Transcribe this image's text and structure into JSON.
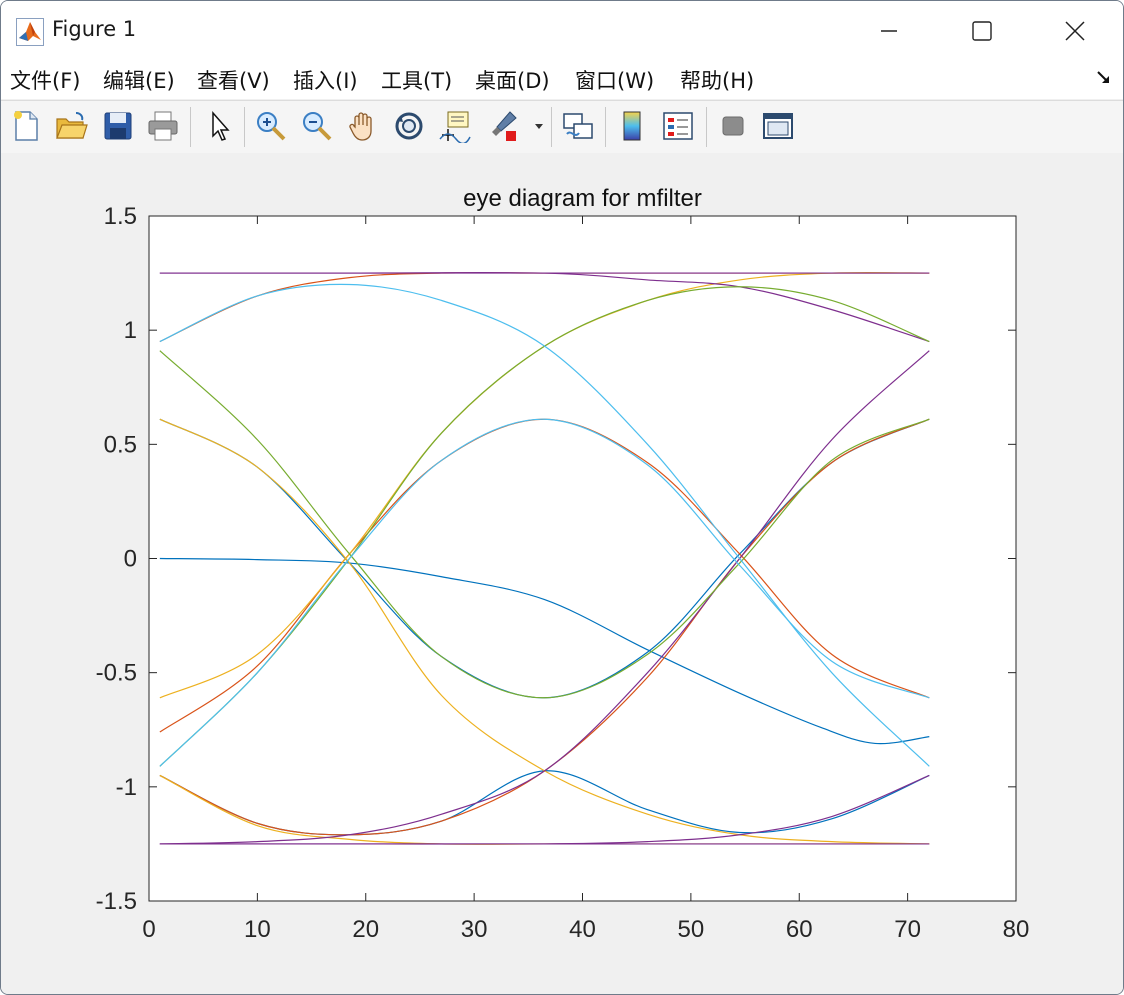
{
  "window": {
    "title": "Figure 1"
  },
  "menu": [
    {
      "label": "文件(F)"
    },
    {
      "label": "编辑(E)"
    },
    {
      "label": "查看(V)"
    },
    {
      "label": "插入(I)"
    },
    {
      "label": "工具(T)"
    },
    {
      "label": "桌面(D)"
    },
    {
      "label": "窗口(W)"
    },
    {
      "label": "帮助(H)"
    }
  ],
  "toolbar": [
    {
      "icon": "new-figure-icon"
    },
    {
      "icon": "open-file-icon"
    },
    {
      "icon": "save-icon"
    },
    {
      "icon": "print-icon"
    },
    {
      "icon": "pointer-icon"
    },
    {
      "icon": "zoom-in-icon"
    },
    {
      "icon": "zoom-out-icon"
    },
    {
      "icon": "pan-icon"
    },
    {
      "icon": "rotate-3d-icon"
    },
    {
      "icon": "data-cursor-icon"
    },
    {
      "icon": "brush-icon"
    },
    {
      "icon": "link-icon"
    },
    {
      "icon": "colorbar-icon"
    },
    {
      "icon": "legend-icon"
    },
    {
      "icon": "hide-plot-tools-icon"
    },
    {
      "icon": "show-plot-tools-icon"
    }
  ],
  "chart_data": {
    "type": "line",
    "title": "eye diagram for mfilter",
    "xlabel": "",
    "ylabel": "",
    "xlim": [
      0,
      80
    ],
    "ylim": [
      -1.5,
      1.5
    ],
    "xticks": [
      0,
      10,
      20,
      30,
      40,
      50,
      60,
      70,
      80
    ],
    "yticks": [
      1.5,
      1,
      0.5,
      0,
      -0.5,
      -1,
      -1.5
    ],
    "ytick_labels": [
      "1.5",
      "1",
      "0.5",
      "0",
      "-0.5",
      "-1",
      "-1.5"
    ],
    "grid": false,
    "colors": [
      "#0072bd",
      "#d95319",
      "#edb120",
      "#7e2f8e",
      "#77ac30",
      "#4dbeee"
    ],
    "series": [
      {
        "color": "#0072bd",
        "points": [
          [
            1,
            0
          ],
          [
            10,
            -0.005
          ],
          [
            18.5,
            -0.02
          ],
          [
            27,
            -0.08
          ],
          [
            36.5,
            -0.18
          ],
          [
            46,
            -0.4
          ],
          [
            54.5,
            -0.59
          ],
          [
            62,
            -0.74
          ],
          [
            67,
            -0.81
          ],
          [
            72,
            -0.78
          ]
        ]
      },
      {
        "color": "#0072bd",
        "points": [
          [
            1,
            0.61
          ],
          [
            10,
            0.4
          ],
          [
            18.5,
            -0.02
          ],
          [
            27,
            -0.43
          ],
          [
            36.5,
            -0.61
          ],
          [
            46,
            -0.41
          ],
          [
            54.5,
            0.02
          ],
          [
            63,
            0.42
          ],
          [
            72,
            0.61
          ]
        ]
      },
      {
        "color": "#0072bd",
        "points": [
          [
            1,
            -0.95
          ],
          [
            10,
            -1.16
          ],
          [
            18.5,
            -1.21
          ],
          [
            27,
            -1.15
          ],
          [
            36.5,
            -0.93
          ],
          [
            46,
            -1.1
          ],
          [
            54.5,
            -1.2
          ],
          [
            63,
            -1.14
          ],
          [
            72,
            -0.95
          ]
        ]
      },
      {
        "color": "#d95319",
        "points": [
          [
            1,
            0.95
          ],
          [
            10,
            1.15
          ],
          [
            18.5,
            1.23
          ],
          [
            27,
            1.25
          ],
          [
            36.5,
            1.25
          ],
          [
            46,
            1.25
          ],
          [
            54.5,
            1.25
          ],
          [
            63,
            1.25
          ],
          [
            72,
            1.25
          ]
        ]
      },
      {
        "color": "#d95319",
        "points": [
          [
            1,
            -0.76
          ],
          [
            10,
            -0.47
          ],
          [
            18.5,
            0.02
          ],
          [
            27,
            0.43
          ],
          [
            36.5,
            0.61
          ],
          [
            46,
            0.42
          ],
          [
            54.5,
            0.02
          ],
          [
            63,
            -0.42
          ],
          [
            72,
            -0.61
          ]
        ]
      },
      {
        "color": "#d95319",
        "points": [
          [
            1,
            -0.95
          ],
          [
            10,
            -1.16
          ],
          [
            18.5,
            -1.21
          ],
          [
            27,
            -1.15
          ],
          [
            36.5,
            -0.93
          ],
          [
            46,
            -0.52
          ],
          [
            54.5,
            0.0
          ],
          [
            63,
            0.42
          ],
          [
            72,
            0.61
          ]
        ]
      },
      {
        "color": "#edb120",
        "points": [
          [
            1,
            0.61
          ],
          [
            10,
            0.4
          ],
          [
            18.5,
            -0.02
          ],
          [
            27,
            -0.6
          ],
          [
            36.5,
            -0.93
          ],
          [
            46,
            -1.12
          ],
          [
            54.5,
            -1.21
          ],
          [
            63,
            -1.24
          ],
          [
            72,
            -1.25
          ]
        ]
      },
      {
        "color": "#edb120",
        "points": [
          [
            1,
            -0.61
          ],
          [
            10,
            -0.42
          ],
          [
            18.5,
            0.02
          ],
          [
            27,
            0.55
          ],
          [
            36.5,
            0.93
          ],
          [
            46,
            1.13
          ],
          [
            54.5,
            1.22
          ],
          [
            63,
            1.25
          ],
          [
            72,
            1.25
          ]
        ]
      },
      {
        "color": "#edb120",
        "points": [
          [
            1,
            -0.95
          ],
          [
            10,
            -1.17
          ],
          [
            18.5,
            -1.23
          ],
          [
            27,
            -1.25
          ],
          [
            36.5,
            -1.25
          ],
          [
            46,
            -1.25
          ],
          [
            54.5,
            -1.25
          ],
          [
            63,
            -1.25
          ],
          [
            72,
            -1.25
          ]
        ]
      },
      {
        "color": "#7e2f8e",
        "points": [
          [
            1,
            1.25
          ],
          [
            18.5,
            1.25
          ],
          [
            36.5,
            1.25
          ],
          [
            54.5,
            1.25
          ],
          [
            72,
            1.25
          ]
        ]
      },
      {
        "color": "#7e2f8e",
        "points": [
          [
            1,
            1.25
          ],
          [
            18.5,
            1.25
          ],
          [
            36.5,
            1.25
          ],
          [
            46,
            1.22
          ],
          [
            54.5,
            1.19
          ],
          [
            63,
            1.09
          ],
          [
            72,
            0.95
          ]
        ]
      },
      {
        "color": "#7e2f8e",
        "points": [
          [
            1,
            -1.25
          ],
          [
            18.5,
            -1.25
          ],
          [
            36.5,
            -1.25
          ],
          [
            54.5,
            -1.25
          ],
          [
            72,
            -1.25
          ]
        ]
      },
      {
        "color": "#7e2f8e",
        "points": [
          [
            1,
            -1.25
          ],
          [
            10,
            -1.24
          ],
          [
            18.5,
            -1.21
          ],
          [
            27,
            -1.12
          ],
          [
            36.5,
            -0.93
          ],
          [
            46,
            -0.5
          ],
          [
            54.5,
            0.0
          ],
          [
            63,
            0.52
          ],
          [
            72,
            0.91
          ]
        ]
      },
      {
        "color": "#7e2f8e",
        "points": [
          [
            1,
            -1.25
          ],
          [
            18.5,
            -1.25
          ],
          [
            36.5,
            -1.25
          ],
          [
            46,
            -1.24
          ],
          [
            54.5,
            -1.21
          ],
          [
            63,
            -1.13
          ],
          [
            72,
            -0.95
          ]
        ]
      },
      {
        "color": "#77ac30",
        "points": [
          [
            1,
            0.91
          ],
          [
            10,
            0.52
          ],
          [
            18.5,
            0.02
          ],
          [
            27,
            -0.43
          ],
          [
            36.5,
            -0.61
          ],
          [
            46,
            -0.42
          ],
          [
            54.5,
            -0.02
          ],
          [
            63,
            0.43
          ],
          [
            72,
            0.61
          ]
        ]
      },
      {
        "color": "#77ac30",
        "points": [
          [
            1,
            -0.91
          ],
          [
            10,
            -0.5
          ],
          [
            18.5,
            0.0
          ],
          [
            27,
            0.55
          ],
          [
            36.5,
            0.93
          ],
          [
            46,
            1.13
          ],
          [
            54.5,
            1.19
          ],
          [
            63,
            1.13
          ],
          [
            72,
            0.95
          ]
        ]
      },
      {
        "color": "#4dbeee",
        "points": [
          [
            1,
            0.95
          ],
          [
            10,
            1.15
          ],
          [
            18.5,
            1.2
          ],
          [
            27,
            1.13
          ],
          [
            36.5,
            0.93
          ],
          [
            46,
            0.5
          ],
          [
            54.5,
            0.0
          ],
          [
            63,
            -0.5
          ],
          [
            72,
            -0.91
          ]
        ]
      },
      {
        "color": "#4dbeee",
        "points": [
          [
            1,
            -0.91
          ],
          [
            10,
            -0.5
          ],
          [
            18.5,
            0.0
          ],
          [
            27,
            0.43
          ],
          [
            36.5,
            0.61
          ],
          [
            46,
            0.41
          ],
          [
            54.5,
            -0.03
          ],
          [
            63,
            -0.45
          ],
          [
            72,
            -0.61
          ]
        ]
      }
    ]
  }
}
